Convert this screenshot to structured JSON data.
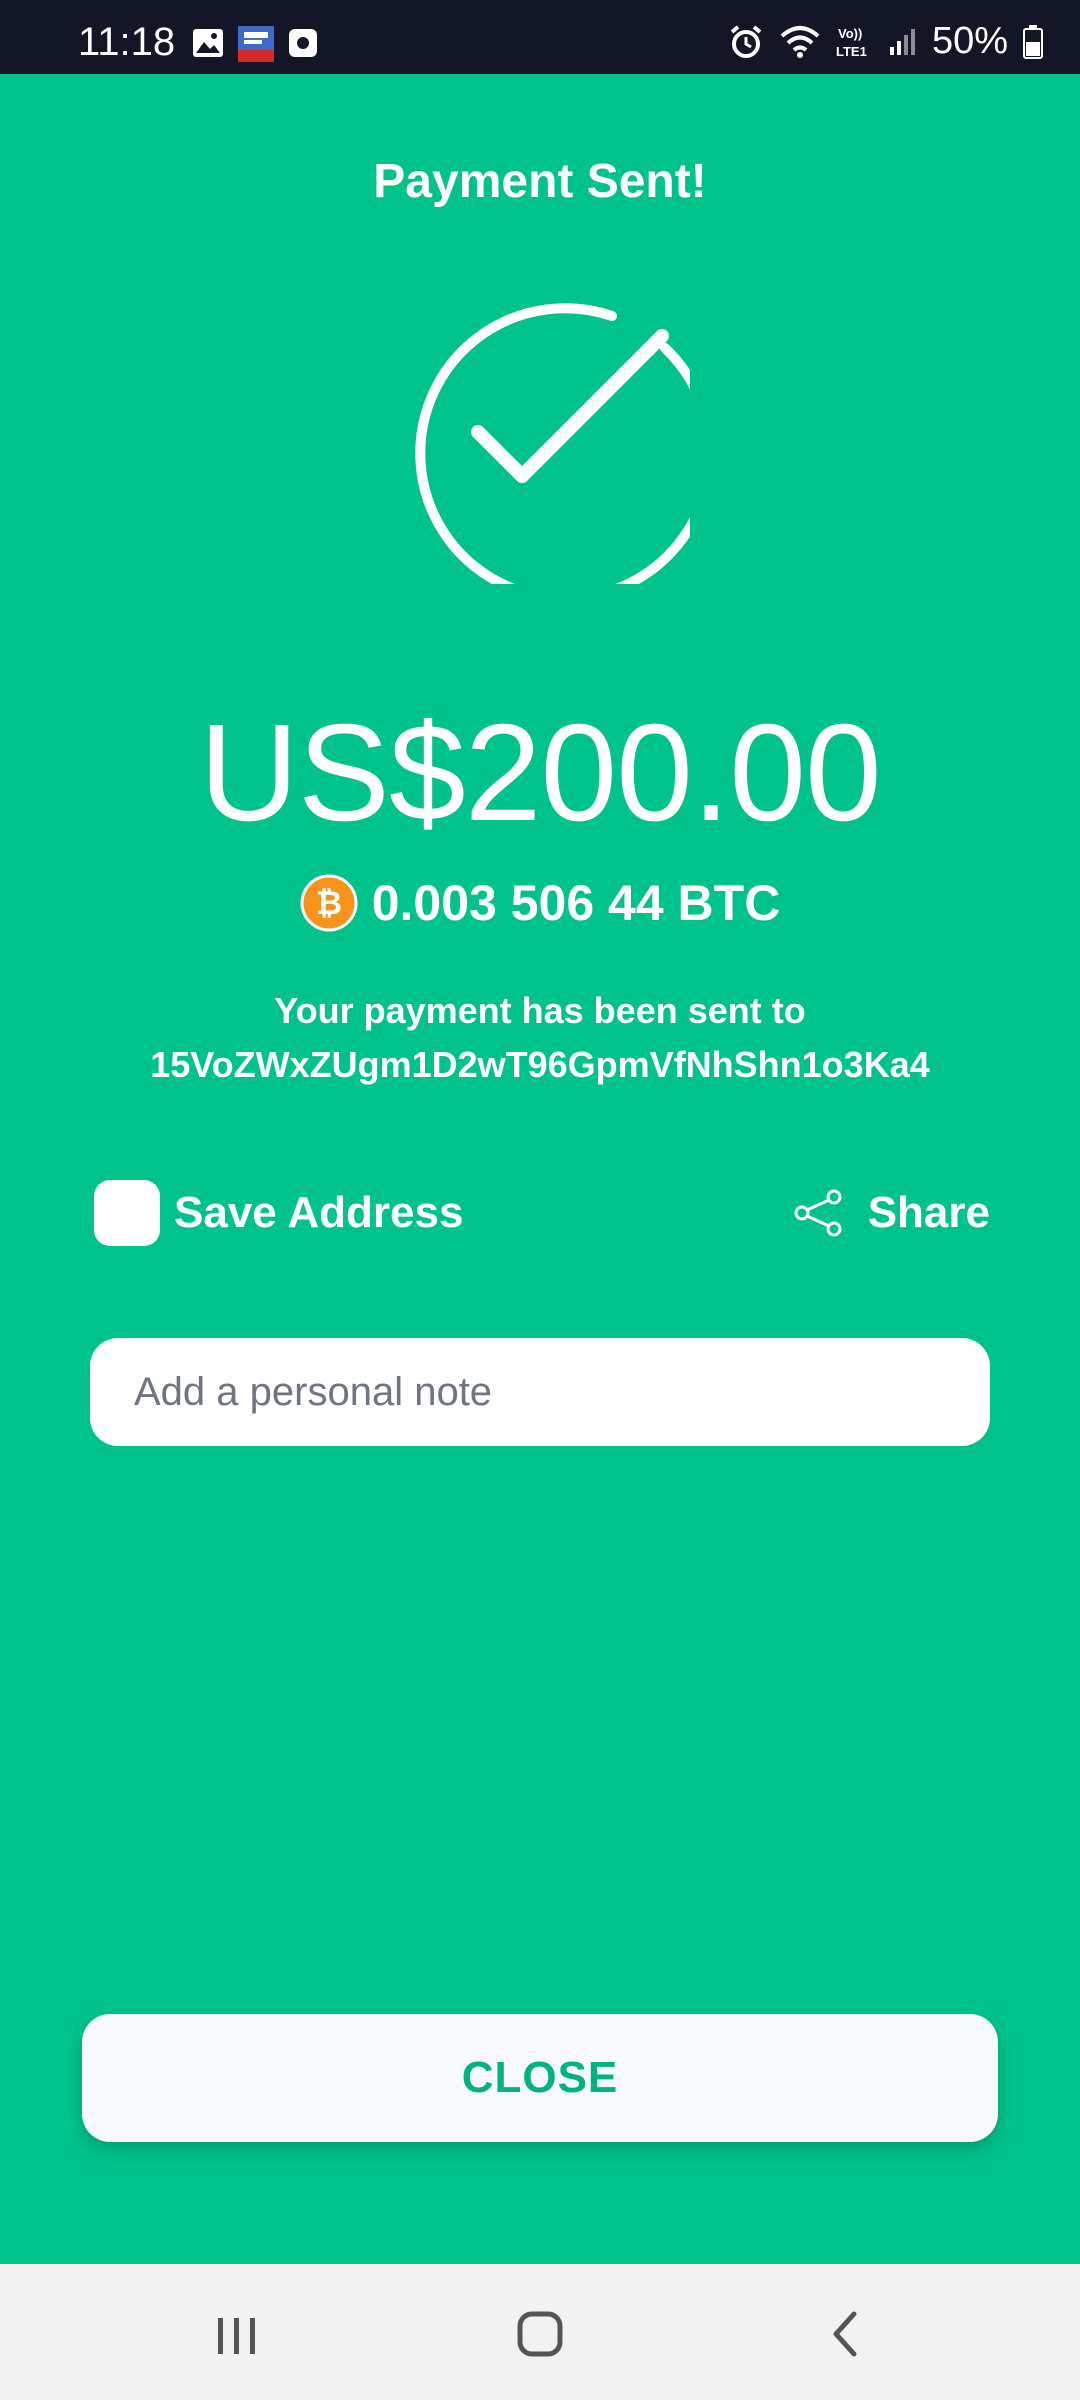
{
  "status_bar": {
    "time": "11:18",
    "battery": "50%",
    "icons": [
      "gallery-icon",
      "news-app-icon",
      "screen-record-icon",
      "alarm-icon",
      "wifi-icon",
      "volte-lte-icon",
      "signal-icon",
      "battery-icon"
    ]
  },
  "payment": {
    "title": "Payment Sent!",
    "amount": "US$200.00",
    "btc_amount": "0.003 506 44 BTC",
    "sent_line1": "Your payment has been sent to",
    "address": "15VoZWxZUgm1D2wT96GpmVfNhShn1o3Ka4"
  },
  "actions": {
    "save_address_label": "Save Address",
    "share_label": "Share",
    "note_placeholder": "Add a personal note",
    "close_label": "CLOSE"
  },
  "colors": {
    "background": "#00c38b",
    "bitcoin": "#f7931a",
    "close_text": "#00b381"
  },
  "nav": {
    "icons": [
      "recent-apps-icon",
      "home-icon",
      "back-icon"
    ]
  }
}
